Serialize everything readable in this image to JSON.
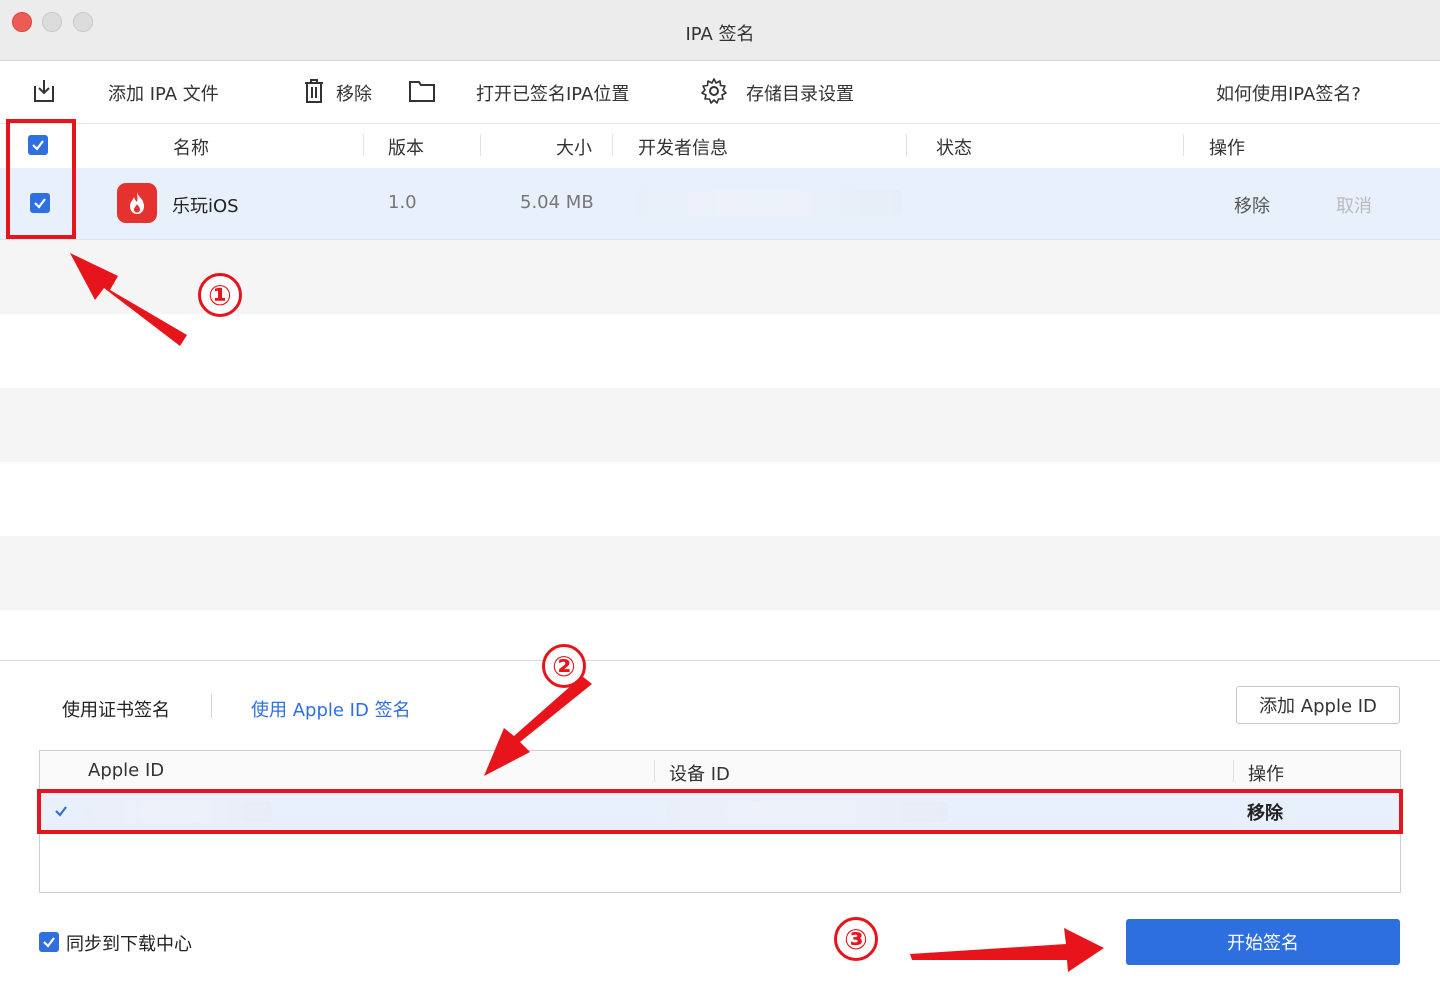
{
  "window": {
    "title": "IPA 签名"
  },
  "toolbar": {
    "add_ipa": "添加 IPA 文件",
    "remove": "移除",
    "open_signed": "打开已签名IPA位置",
    "storage_settings": "存储目录设置",
    "help": "如何使用IPA签名?"
  },
  "table": {
    "headers": {
      "name": "名称",
      "version": "版本",
      "size": "大小",
      "developer": "开发者信息",
      "status": "状态",
      "actions": "操作"
    },
    "rows": [
      {
        "checked": true,
        "name": "乐玩iOS",
        "version": "1.0",
        "size": "5.04 MB",
        "developer": "",
        "status": "",
        "action_remove": "移除",
        "action_cancel": "取消"
      }
    ]
  },
  "signing": {
    "tab_cert": "使用证书签名",
    "tab_apple_id": "使用 Apple ID 签名",
    "add_apple_id": "添加 Apple ID",
    "id_table": {
      "headers": {
        "apple_id": "Apple ID",
        "device_id": "设备 ID",
        "actions": "操作"
      },
      "rows": [
        {
          "selected": true,
          "apple_id": "",
          "device_id": "",
          "action_remove": "移除"
        }
      ]
    },
    "sync_label": "同步到下载中心",
    "sync_checked": true,
    "start_button": "开始签名"
  },
  "annotations": {
    "step1": "①",
    "step2": "②",
    "step3": "③"
  },
  "colors": {
    "accent": "#2e6fe0",
    "link": "#2f6fe0",
    "selected_row": "#e8f0fc",
    "annotation_red": "#e8141b",
    "app_icon_red": "#e5322f"
  },
  "icons": {
    "add_ipa": "download-tray-icon",
    "remove": "trash-icon",
    "open_signed": "folder-icon",
    "storage_settings": "gear-icon",
    "app": "flame-icon"
  }
}
